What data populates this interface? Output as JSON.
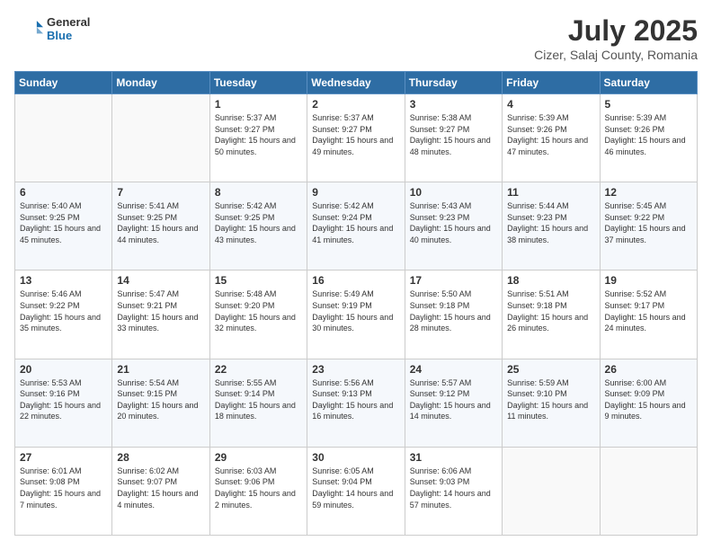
{
  "header": {
    "logo_general": "General",
    "logo_blue": "Blue",
    "month_title": "July 2025",
    "location": "Cizer, Salaj County, Romania"
  },
  "weekdays": [
    "Sunday",
    "Monday",
    "Tuesday",
    "Wednesday",
    "Thursday",
    "Friday",
    "Saturday"
  ],
  "weeks": [
    [
      {
        "day": "",
        "info": ""
      },
      {
        "day": "",
        "info": ""
      },
      {
        "day": "1",
        "info": "Sunrise: 5:37 AM\nSunset: 9:27 PM\nDaylight: 15 hours and 50 minutes."
      },
      {
        "day": "2",
        "info": "Sunrise: 5:37 AM\nSunset: 9:27 PM\nDaylight: 15 hours and 49 minutes."
      },
      {
        "day": "3",
        "info": "Sunrise: 5:38 AM\nSunset: 9:27 PM\nDaylight: 15 hours and 48 minutes."
      },
      {
        "day": "4",
        "info": "Sunrise: 5:39 AM\nSunset: 9:26 PM\nDaylight: 15 hours and 47 minutes."
      },
      {
        "day": "5",
        "info": "Sunrise: 5:39 AM\nSunset: 9:26 PM\nDaylight: 15 hours and 46 minutes."
      }
    ],
    [
      {
        "day": "6",
        "info": "Sunrise: 5:40 AM\nSunset: 9:25 PM\nDaylight: 15 hours and 45 minutes."
      },
      {
        "day": "7",
        "info": "Sunrise: 5:41 AM\nSunset: 9:25 PM\nDaylight: 15 hours and 44 minutes."
      },
      {
        "day": "8",
        "info": "Sunrise: 5:42 AM\nSunset: 9:25 PM\nDaylight: 15 hours and 43 minutes."
      },
      {
        "day": "9",
        "info": "Sunrise: 5:42 AM\nSunset: 9:24 PM\nDaylight: 15 hours and 41 minutes."
      },
      {
        "day": "10",
        "info": "Sunrise: 5:43 AM\nSunset: 9:23 PM\nDaylight: 15 hours and 40 minutes."
      },
      {
        "day": "11",
        "info": "Sunrise: 5:44 AM\nSunset: 9:23 PM\nDaylight: 15 hours and 38 minutes."
      },
      {
        "day": "12",
        "info": "Sunrise: 5:45 AM\nSunset: 9:22 PM\nDaylight: 15 hours and 37 minutes."
      }
    ],
    [
      {
        "day": "13",
        "info": "Sunrise: 5:46 AM\nSunset: 9:22 PM\nDaylight: 15 hours and 35 minutes."
      },
      {
        "day": "14",
        "info": "Sunrise: 5:47 AM\nSunset: 9:21 PM\nDaylight: 15 hours and 33 minutes."
      },
      {
        "day": "15",
        "info": "Sunrise: 5:48 AM\nSunset: 9:20 PM\nDaylight: 15 hours and 32 minutes."
      },
      {
        "day": "16",
        "info": "Sunrise: 5:49 AM\nSunset: 9:19 PM\nDaylight: 15 hours and 30 minutes."
      },
      {
        "day": "17",
        "info": "Sunrise: 5:50 AM\nSunset: 9:18 PM\nDaylight: 15 hours and 28 minutes."
      },
      {
        "day": "18",
        "info": "Sunrise: 5:51 AM\nSunset: 9:18 PM\nDaylight: 15 hours and 26 minutes."
      },
      {
        "day": "19",
        "info": "Sunrise: 5:52 AM\nSunset: 9:17 PM\nDaylight: 15 hours and 24 minutes."
      }
    ],
    [
      {
        "day": "20",
        "info": "Sunrise: 5:53 AM\nSunset: 9:16 PM\nDaylight: 15 hours and 22 minutes."
      },
      {
        "day": "21",
        "info": "Sunrise: 5:54 AM\nSunset: 9:15 PM\nDaylight: 15 hours and 20 minutes."
      },
      {
        "day": "22",
        "info": "Sunrise: 5:55 AM\nSunset: 9:14 PM\nDaylight: 15 hours and 18 minutes."
      },
      {
        "day": "23",
        "info": "Sunrise: 5:56 AM\nSunset: 9:13 PM\nDaylight: 15 hours and 16 minutes."
      },
      {
        "day": "24",
        "info": "Sunrise: 5:57 AM\nSunset: 9:12 PM\nDaylight: 15 hours and 14 minutes."
      },
      {
        "day": "25",
        "info": "Sunrise: 5:59 AM\nSunset: 9:10 PM\nDaylight: 15 hours and 11 minutes."
      },
      {
        "day": "26",
        "info": "Sunrise: 6:00 AM\nSunset: 9:09 PM\nDaylight: 15 hours and 9 minutes."
      }
    ],
    [
      {
        "day": "27",
        "info": "Sunrise: 6:01 AM\nSunset: 9:08 PM\nDaylight: 15 hours and 7 minutes."
      },
      {
        "day": "28",
        "info": "Sunrise: 6:02 AM\nSunset: 9:07 PM\nDaylight: 15 hours and 4 minutes."
      },
      {
        "day": "29",
        "info": "Sunrise: 6:03 AM\nSunset: 9:06 PM\nDaylight: 15 hours and 2 minutes."
      },
      {
        "day": "30",
        "info": "Sunrise: 6:05 AM\nSunset: 9:04 PM\nDaylight: 14 hours and 59 minutes."
      },
      {
        "day": "31",
        "info": "Sunrise: 6:06 AM\nSunset: 9:03 PM\nDaylight: 14 hours and 57 minutes."
      },
      {
        "day": "",
        "info": ""
      },
      {
        "day": "",
        "info": ""
      }
    ]
  ]
}
